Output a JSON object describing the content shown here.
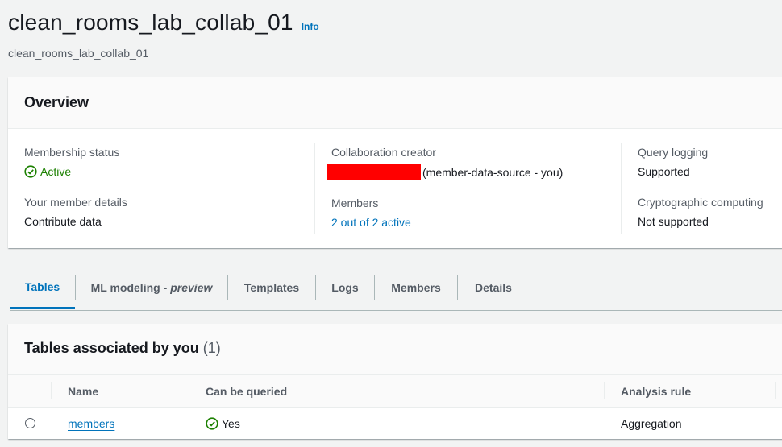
{
  "header": {
    "title": "clean_rooms_lab_collab_01",
    "info_label": "Info",
    "subtitle": "clean_rooms_lab_collab_01"
  },
  "overview": {
    "title": "Overview",
    "membership_status_label": "Membership status",
    "membership_status_value": "Active",
    "member_details_label": "Your member details",
    "member_details_value": "Contribute data",
    "creator_label": "Collaboration creator",
    "creator_suffix": "(member-data-source - you)",
    "members_label": "Members",
    "members_value": "2 out of 2 active",
    "query_logging_label": "Query logging",
    "query_logging_value": "Supported",
    "crypto_label": "Cryptographic computing",
    "crypto_value": "Not supported"
  },
  "tabs": {
    "tables": "Tables",
    "ml_modeling": "ML modeling -",
    "ml_preview": "preview",
    "templates": "Templates",
    "logs": "Logs",
    "members": "Members",
    "details": "Details"
  },
  "tables_panel": {
    "title": "Tables associated by you",
    "count": "(1)",
    "columns": [
      "Name",
      "Can be queried",
      "Analysis rule"
    ],
    "rows": [
      {
        "name": "members",
        "can_be_queried": "Yes",
        "analysis_rule": "Aggregation"
      }
    ]
  },
  "colors": {
    "link": "#0073bb",
    "success": "#1d8102",
    "redaction": "#ff0000"
  }
}
